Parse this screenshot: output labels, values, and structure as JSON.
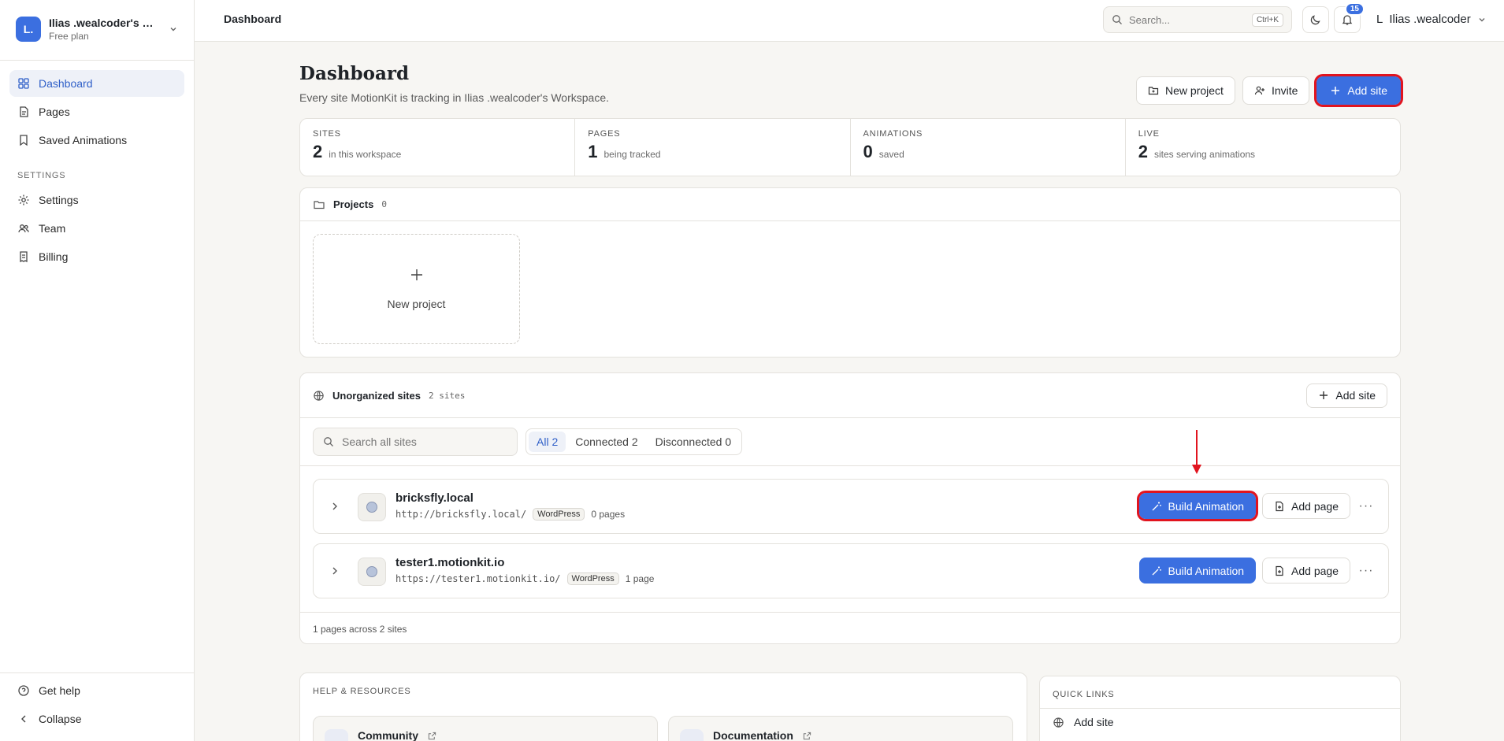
{
  "workspace": {
    "initial": "L.",
    "name": "Ilias .wealcoder's W...",
    "plan": "Free plan"
  },
  "sidebar": {
    "items": [
      {
        "label": "Dashboard",
        "icon": "grid-icon"
      },
      {
        "label": "Pages",
        "icon": "pages-icon"
      },
      {
        "label": "Saved Animations",
        "icon": "bookmark-icon"
      }
    ],
    "settings_label": "SETTINGS",
    "settings_items": [
      {
        "label": "Settings",
        "icon": "gear-icon"
      },
      {
        "label": "Team",
        "icon": "users-icon"
      },
      {
        "label": "Billing",
        "icon": "receipt-icon"
      }
    ],
    "help": "Get help",
    "collapse": "Collapse"
  },
  "topbar": {
    "title": "Dashboard",
    "search_placeholder": "Search...",
    "shortcut": "Ctrl+K",
    "notifications": "15",
    "user_initial": "L",
    "user_name": "Ilias .wealcoder"
  },
  "page": {
    "title": "Dashboard",
    "subtitle": "Every site MotionKit is tracking in Ilias .wealcoder's Workspace.",
    "actions": {
      "new_project": "New project",
      "invite": "Invite",
      "add_site": "Add site"
    }
  },
  "stats": [
    {
      "label": "SITES",
      "value": "2",
      "caption": "in this workspace"
    },
    {
      "label": "PAGES",
      "value": "1",
      "caption": "being tracked"
    },
    {
      "label": "ANIMATIONS",
      "value": "0",
      "caption": "saved"
    },
    {
      "label": "LIVE",
      "value": "2",
      "caption": "sites serving animations"
    }
  ],
  "projects": {
    "title": "Projects",
    "count": "0",
    "new_label": "New project"
  },
  "unorganized": {
    "title": "Unorganized sites",
    "count": "2 sites",
    "add_site": "Add site",
    "search_placeholder": "Search all sites",
    "filters": [
      {
        "label": "All 2",
        "active": true
      },
      {
        "label": "Connected 2",
        "active": false
      },
      {
        "label": "Disconnected 0",
        "active": false
      }
    ],
    "sites": [
      {
        "name": "bricksfly.local",
        "url": "http://bricksfly.local/",
        "platform": "WordPress",
        "pages": "0 pages",
        "build": "Build Animation",
        "add_page": "Add page"
      },
      {
        "name": "tester1.motionkit.io",
        "url": "https://tester1.motionkit.io/",
        "platform": "WordPress",
        "pages": "1 page",
        "build": "Build Animation",
        "add_page": "Add page"
      }
    ],
    "footer": "1 pages across 2 sites"
  },
  "help": {
    "title": "HELP & RESOURCES",
    "items": [
      {
        "label": "Community"
      },
      {
        "label": "Documentation"
      }
    ]
  },
  "quick_links": {
    "title": "QUICK LINKS",
    "items": [
      {
        "label": "Add site"
      }
    ]
  },
  "colors": {
    "accent": "#3b6fe0",
    "highlight": "#e1141f"
  }
}
